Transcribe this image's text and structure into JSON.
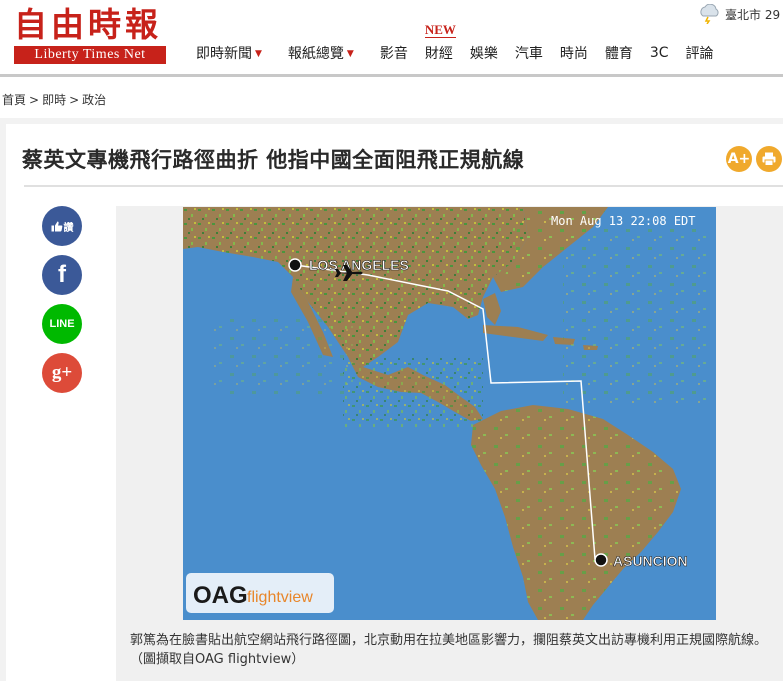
{
  "header": {
    "logo_cn": "自由時報",
    "logo_en": "Liberty Times Net",
    "new_badge": "NEW",
    "nav": [
      {
        "label": "即時新聞",
        "dropdown": true
      },
      {
        "label": "報紙總覽",
        "dropdown": true
      },
      {
        "label": "影音",
        "dropdown": false
      },
      {
        "label": "財經",
        "dropdown": false
      },
      {
        "label": "娛樂",
        "dropdown": false
      },
      {
        "label": "汽車",
        "dropdown": false
      },
      {
        "label": "時尚",
        "dropdown": false
      },
      {
        "label": "體育",
        "dropdown": false
      },
      {
        "label": "3C",
        "dropdown": false
      },
      {
        "label": "評論",
        "dropdown": false
      }
    ],
    "weather": "臺北市 29"
  },
  "breadcrumb": [
    "首頁",
    "即時",
    "政治"
  ],
  "article": {
    "title": "蔡英文專機飛行路徑曲折 他指中國全面阻飛正規航線",
    "font_button": "A+",
    "print_icon": "printer-icon",
    "share": {
      "like_label": "讚",
      "facebook_label": "f",
      "line_label": "LINE",
      "gplus_label": "g+"
    },
    "map": {
      "timestamp": "Mon Aug 13 22:08 EDT",
      "origin_label": "LOS ANGELES",
      "destination_label": "ASUNCION",
      "watermark_oag": "OAG",
      "watermark_fv": "flightview"
    },
    "caption": "郭篤為在臉書貼出航空網站飛行路徑圖，北京動用在拉美地區影響力，攔阻蔡英文出訪專機利用正規國際航線。（圖擷取自OAG flightview）"
  },
  "colors": {
    "brand_red": "#c7221a",
    "ocean": "#4a8ecc",
    "land": "#9d7f52",
    "facebook": "#3b5998",
    "line": "#00b900",
    "gplus": "#dd4b39",
    "tool": "#f0a92c"
  }
}
